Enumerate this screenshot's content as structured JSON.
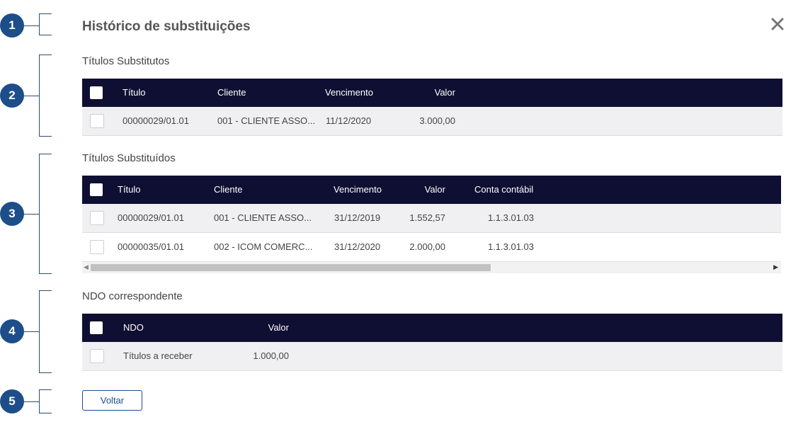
{
  "annotations": [
    "1",
    "2",
    "3",
    "4",
    "5"
  ],
  "dialog": {
    "title": "Histórico de substituições",
    "close_icon": "close-icon"
  },
  "substitutes": {
    "title": "Títulos Substitutos",
    "columns": [
      "Título",
      "Cliente",
      "Vencimento",
      "Valor"
    ],
    "rows": [
      [
        "00000029/01.01",
        "001 - CLIENTE ASSO...",
        "11/12/2020",
        "3.000,00"
      ]
    ]
  },
  "substituted": {
    "title": "Títulos Substituídos",
    "columns": [
      "Título",
      "Cliente",
      "Vencimento",
      "Valor",
      "Conta contábil"
    ],
    "rows": [
      [
        "00000029/01.01",
        "001 - CLIENTE ASSO...",
        "31/12/2019",
        "1.552,57",
        "1.1.3.01.03"
      ],
      [
        "00000035/01.01",
        "002 - ICOM COMERC...",
        "31/12/2020",
        "2.000,00",
        "1.1.3.01.03"
      ]
    ]
  },
  "ndo": {
    "title": "NDO correspondente",
    "columns": [
      "NDO",
      "Valor"
    ],
    "rows": [
      [
        "Títulos a receber",
        "1.000,00"
      ]
    ]
  },
  "footer": {
    "back_label": "Voltar"
  },
  "colors": {
    "header_bg": "#0f0f33",
    "marker": "#1d4e8a",
    "row_shade": "#f0f0f2"
  }
}
